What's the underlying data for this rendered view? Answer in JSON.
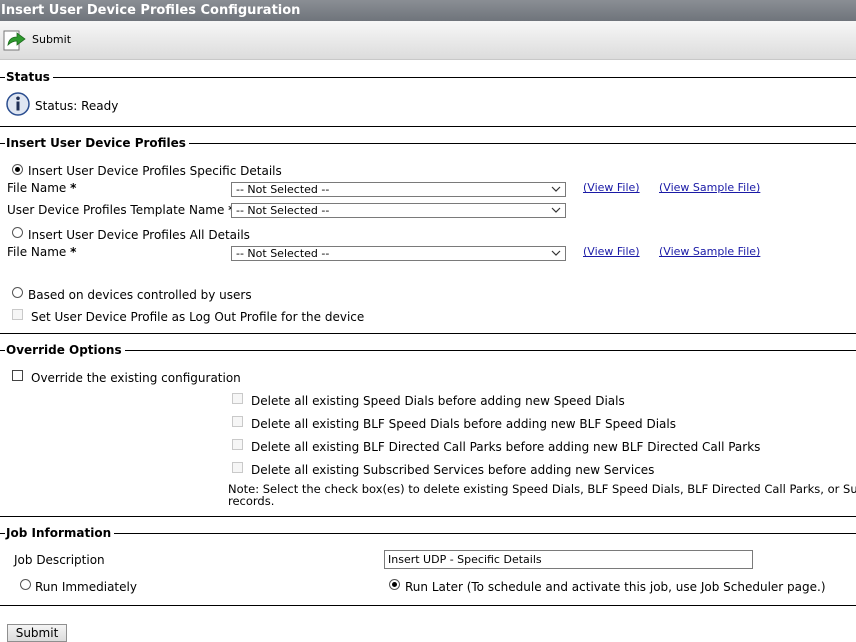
{
  "window": {
    "title": "Insert User Device Profiles Configuration"
  },
  "toolbar": {
    "submit_label": "Submit"
  },
  "status": {
    "legend": "Status",
    "text": "Status: Ready"
  },
  "insert": {
    "legend": "Insert User Device Profiles",
    "specific_radio_label": "Insert User Device Profiles Specific Details",
    "file_name_label": "File Name",
    "required_mark": "*",
    "file_name_value": "-- Not Selected --",
    "template_label": "User Device Profiles Template Name",
    "template_value": "-- Not Selected --",
    "view_file": "(View File)",
    "view_sample_file": "(View Sample File)",
    "all_radio_label": "Insert User Device Profiles All Details",
    "all_file_name_label": "File Name",
    "all_file_name_value": "-- Not Selected --",
    "based_radio_label": "Based on devices controlled by users",
    "logout_checkbox_label": "Set User Device Profile as Log Out Profile for the device"
  },
  "override": {
    "legend": "Override Options",
    "override_label": "Override the existing configuration",
    "opt1": "Delete all existing Speed Dials before adding new Speed Dials",
    "opt2": "Delete all existing BLF Speed Dials before adding new BLF Speed Dials",
    "opt3": "Delete all existing BLF Directed Call Parks before adding new BLF Directed Call Parks",
    "opt4": "Delete all existing Subscribed Services before adding new Services",
    "note_line1": "Note: Select the check box(es) to delete existing Speed Dials, BLF Speed Dials, BLF Directed Call Parks, or Su",
    "note_line2": "records."
  },
  "job": {
    "legend": "Job Information",
    "description_label": "Job Description",
    "description_value": "Insert UDP - Specific Details",
    "run_immediately": "Run Immediately",
    "run_later": "Run Later (To schedule and activate this job, use Job Scheduler page.)"
  },
  "footer": {
    "submit_label": "Submit"
  },
  "state": {
    "selected_insert_mode": "specific",
    "run_option": "later",
    "override_checked": false
  },
  "colors": {
    "titlebar": "#7a7e84",
    "link": "#1a1aa6",
    "icon_green": "#2e9a2e",
    "info_blue": "#2a4d8f"
  }
}
